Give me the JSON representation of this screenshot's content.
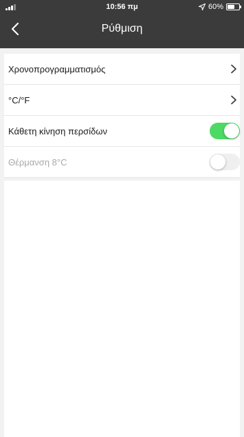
{
  "status_bar": {
    "time": "10:56 πμ",
    "battery": "60%",
    "battery_level": 0.6,
    "icons": [
      "signal-icon",
      "location-arrow-icon",
      "battery-icon"
    ]
  },
  "nav": {
    "title": "Ρύθμιση",
    "back_icon": "chevron-left-icon"
  },
  "settings": {
    "items": [
      {
        "label": "Χρονοπρογραμματισμός",
        "control": "chevron"
      },
      {
        "label": "°C/°F",
        "control": "chevron"
      },
      {
        "label": "Κάθετη κίνηση περσίδων",
        "control": "toggle",
        "on": true
      },
      {
        "label": "Θέρμανση 8°C",
        "control": "toggle",
        "on": false,
        "disabled": true
      }
    ]
  },
  "colors": {
    "header_bg": "#3b3b3b",
    "toggle_on": "#4cd964",
    "page_bg": "#f2f2f2"
  }
}
